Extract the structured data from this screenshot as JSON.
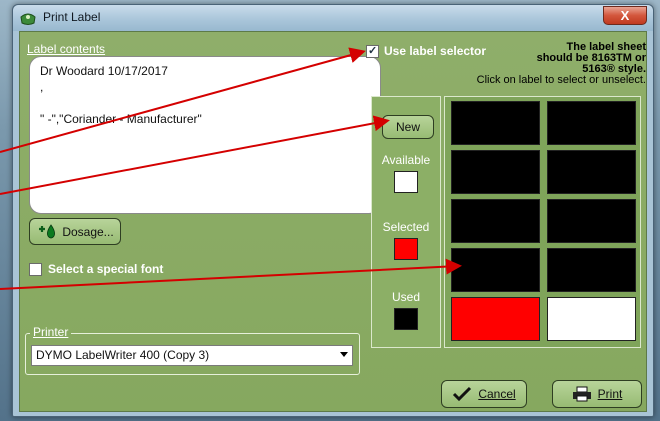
{
  "window": {
    "title": "Print Label",
    "close_label": "X"
  },
  "label_contents": {
    "caption": "Label contents",
    "lines": [
      "Dr Woodard 10/17/2017",
      ",",
      "",
      "\" -\",\"Coriander - Manufacturer\""
    ]
  },
  "dosage_button": {
    "label": "Dosage..."
  },
  "special_font": {
    "label": "Select a special font",
    "checked": false
  },
  "printer": {
    "caption": "Printer",
    "selected": "DYMO LabelWriter 400 (Copy 3)"
  },
  "label_selector": {
    "label": "Use label selector",
    "checked": true,
    "sheet_note_lines": [
      "The label sheet",
      "should be 8163TM or",
      "5163®  style.",
      "Click on label to select or unselect."
    ]
  },
  "legend": {
    "new_label": "New",
    "available_label": "Available",
    "selected_label": "Selected",
    "used_label": "Used",
    "colors": {
      "available": "#ffffff",
      "selected": "#ff0000",
      "used": "#000000"
    }
  },
  "label_grid": {
    "columns": 2,
    "rows": 5,
    "cells": [
      "used",
      "used",
      "used",
      "used",
      "used",
      "used",
      "used",
      "used",
      "selected",
      "available"
    ]
  },
  "buttons": {
    "cancel_label": "Cancel",
    "print_label": "Print"
  },
  "colors": {
    "dialog_bg": "#88aa61",
    "annotation_arrow": "#d40000"
  }
}
